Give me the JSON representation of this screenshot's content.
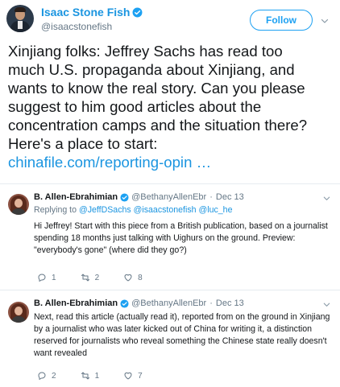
{
  "main_tweet": {
    "display_name": "Isaac Stone Fish",
    "handle": "@isaacstonefish",
    "follow_label": "Follow",
    "text_lines": [
      "Xinjiang folks: Jeffrey Sachs has read too",
      "much U.S. propaganda about Xinjiang, and",
      "wants to know the real story. Can you please",
      "suggest to him good articles about the",
      "concentration camps and the situation there?",
      "Here's a place to start:"
    ],
    "link": "chinafile.com/reporting-opin …",
    "colors": {
      "accent": "#1da1f2",
      "link": "#1b95e0",
      "text": "#14171a",
      "muted": "#657786"
    }
  },
  "replies": [
    {
      "display_name": "B. Allen-Ebrahimian",
      "handle": "@BethanyAllenEbr",
      "dot": "·",
      "date": "Dec 13",
      "replying_prefix": "Replying to",
      "replying_mentions": [
        "@JeffDSachs",
        "@isaacstonefish",
        "@luc_he"
      ],
      "replying_separators": [
        " ",
        " ",
        " "
      ],
      "body_lines": [
        "Hi Jeffrey! Start with this piece from a British publication, based on a journalist",
        "spending 18 months just talking with Uighurs on the ground. Preview:",
        "\"everybody's gone\" (where did they go?)"
      ],
      "actions": {
        "replies": "1",
        "retweets": "2",
        "likes": "8"
      }
    },
    {
      "display_name": "B. Allen-Ebrahimian",
      "handle": "@BethanyAllenEbr",
      "dot": "·",
      "date": "Dec 13",
      "body_lines": [
        "Next, read this article (actually read it), reported from on the ground in Xinjiang",
        "by a journalist who was later kicked out of China for writing it, a distinction",
        "reserved for journalists who reveal something the Chinese state really doesn't",
        "want revealed"
      ],
      "actions": {
        "replies": "2",
        "retweets": "1",
        "likes": "7"
      }
    }
  ],
  "icons": {
    "verified": "verified-badge-icon",
    "chevron": "chevron-down-icon",
    "reply": "reply-icon",
    "retweet": "retweet-icon",
    "like": "heart-icon"
  }
}
